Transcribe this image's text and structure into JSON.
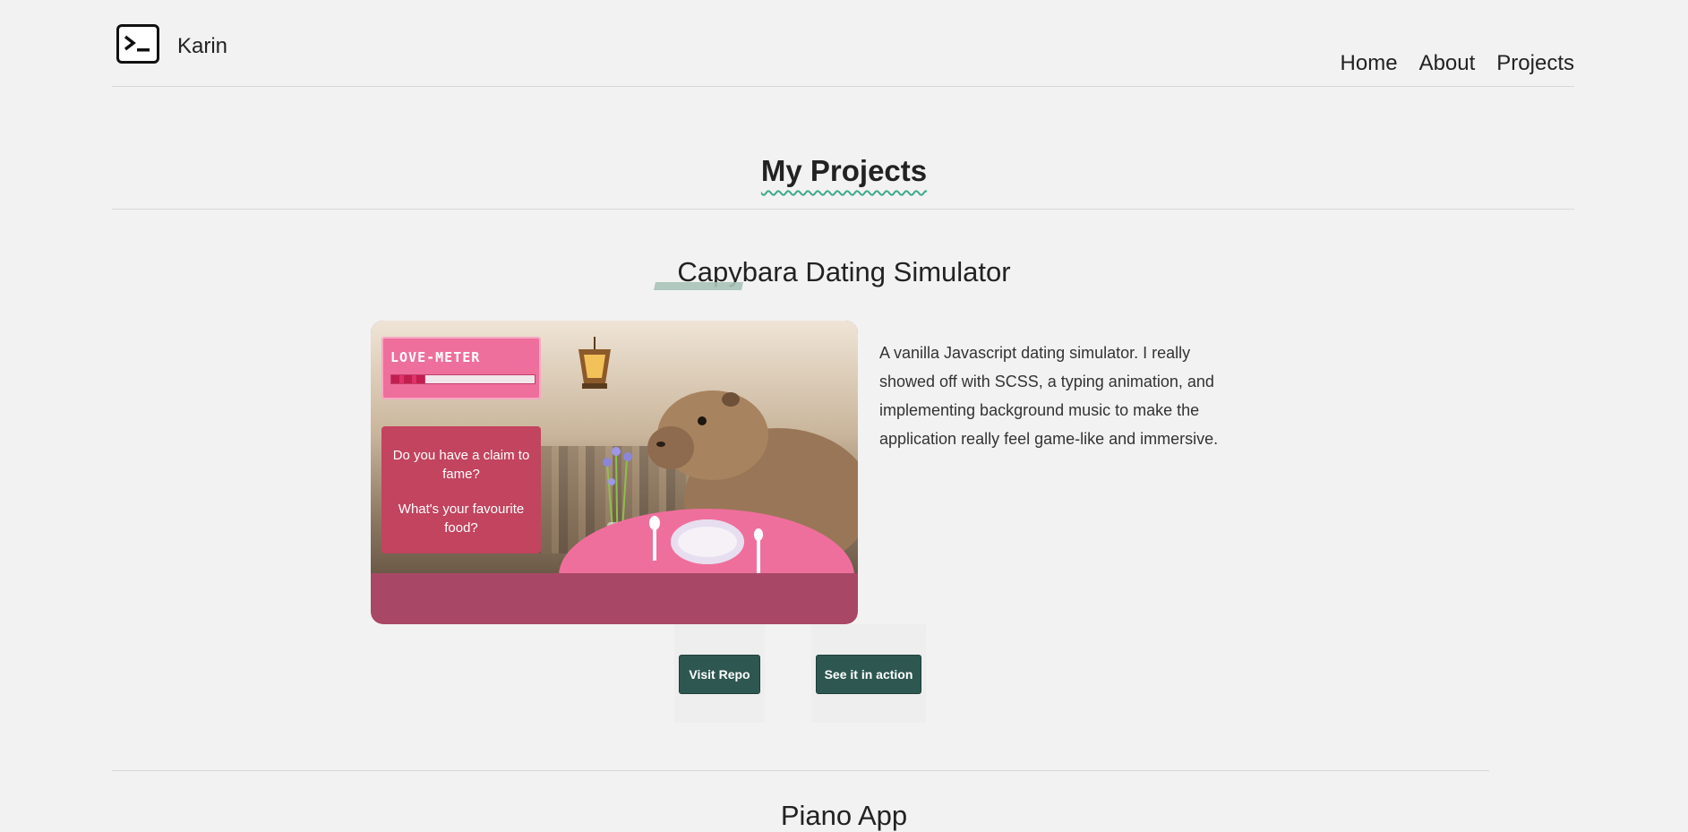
{
  "header": {
    "brand": "Karin",
    "logo_icon": "terminal-icon",
    "nav": [
      "Home",
      "About",
      "Projects"
    ]
  },
  "page": {
    "title": "My Projects"
  },
  "projects": [
    {
      "title": "Capybara Dating Simulator",
      "screenshot": {
        "meter_label": "LOVE-METER",
        "meter_level": 0.24,
        "question_1": "Do you have a claim to fame?",
        "question_2": "What's your favourite food?"
      },
      "description": "A vanilla Javascript dating simulator. I really showed off with SCSS, a typing animation, and implementing background music to make the application really feel game-like and immersive.",
      "buttons": {
        "repo": "Visit Repo",
        "live": "See it in action"
      }
    },
    {
      "title": "Piano App"
    }
  ],
  "colors": {
    "background": "#f2f2f2",
    "button": "#2e5751",
    "accent_underline": "#3fa98a",
    "screenshot_frame": "#a84866"
  }
}
